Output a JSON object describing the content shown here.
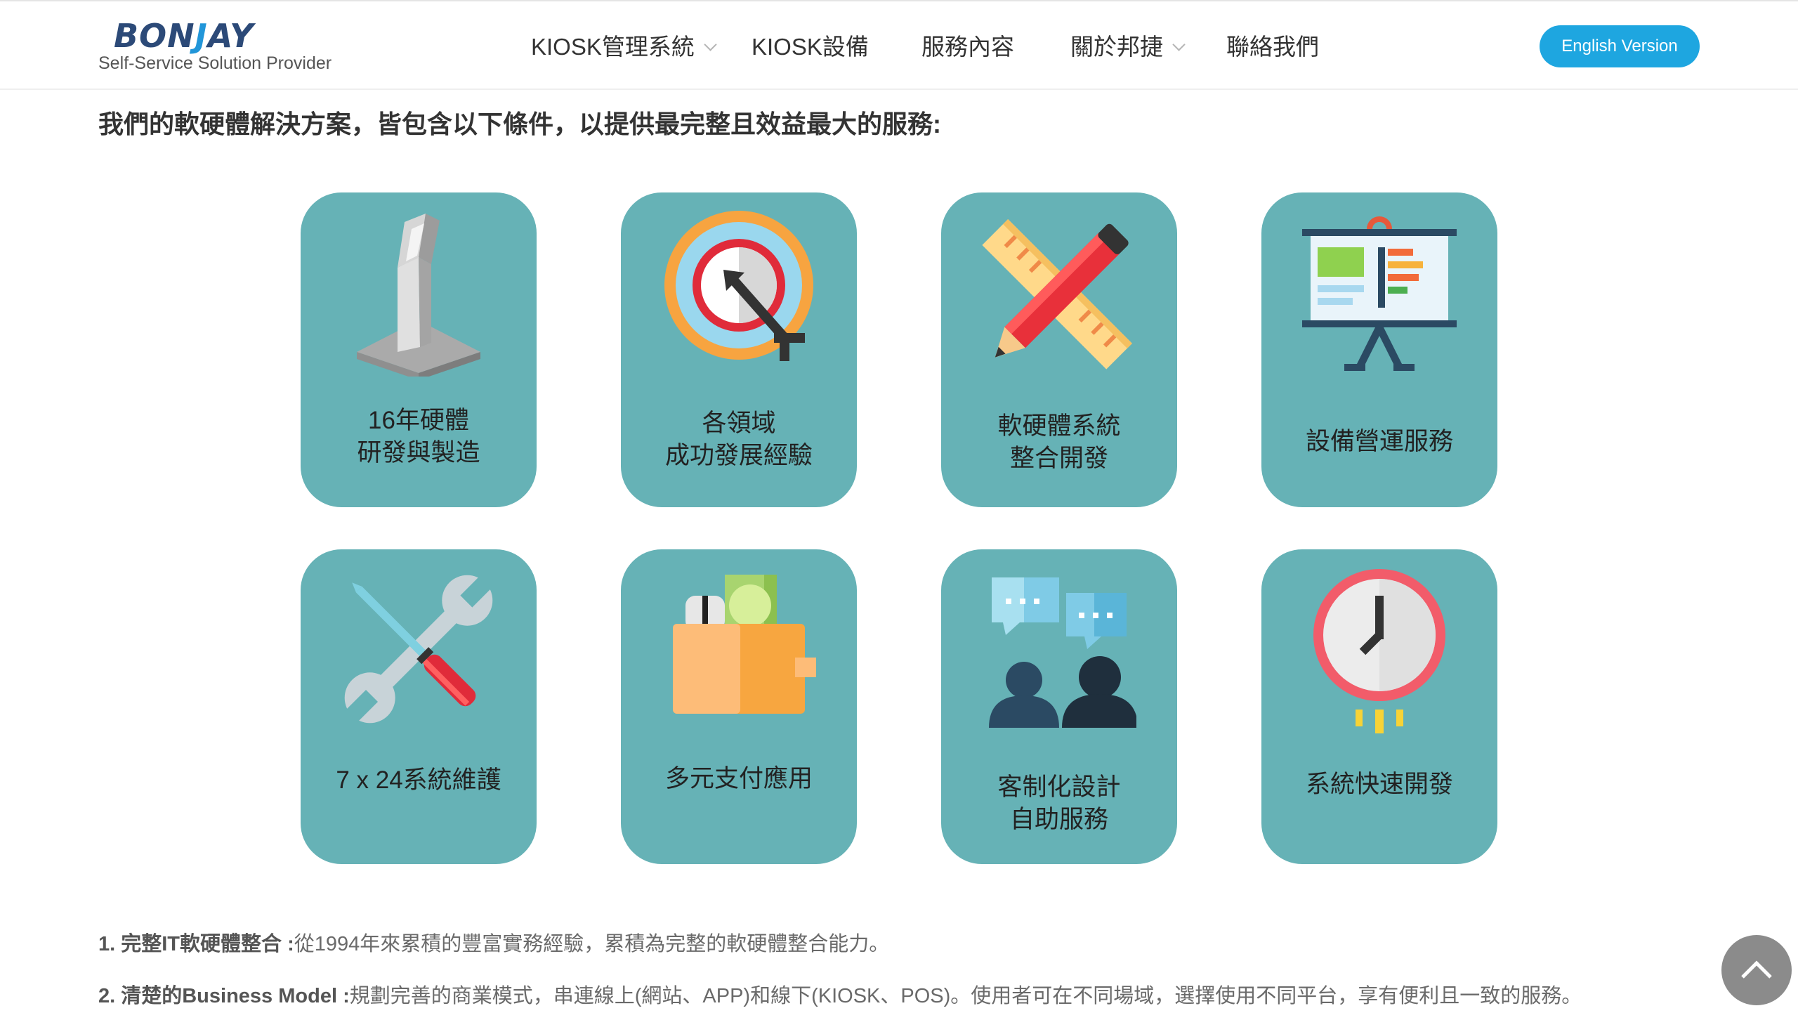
{
  "header": {
    "logo": {
      "word_part1": "BON",
      "word_mark": "J",
      "word_part2": "AY",
      "tagline": "Self-Service Solution Provider"
    },
    "nav": [
      {
        "label": "KIOSK管理系統",
        "has_dropdown": true
      },
      {
        "label": "KIOSK設備",
        "has_dropdown": false
      },
      {
        "label": "服務內容",
        "has_dropdown": false
      },
      {
        "label": "關於邦捷",
        "has_dropdown": true
      },
      {
        "label": "聯絡我們",
        "has_dropdown": false
      }
    ],
    "english_button": "English Version"
  },
  "intro": "我們的軟硬體解決方案，皆包含以下條件，以提供最完整且效益最大的服務:",
  "cards": [
    {
      "icon": "kiosk-icon",
      "line1": "16年硬體",
      "line2": "研發與製造"
    },
    {
      "icon": "target-icon",
      "line1": "各領域",
      "line2": "成功發展經驗"
    },
    {
      "icon": "pencil-ruler-icon",
      "line1": "軟硬體系統",
      "line2": "整合開發"
    },
    {
      "icon": "presentation-board-icon",
      "line1": "設備營運服務",
      "line2": ""
    },
    {
      "icon": "tools-icon",
      "line1": "7 x 24系統維護",
      "line2": ""
    },
    {
      "icon": "wallet-payment-icon",
      "line1": "多元支付應用",
      "line2": ""
    },
    {
      "icon": "chat-users-icon",
      "line1": "客制化設計",
      "line2": "自助服務"
    },
    {
      "icon": "clock-icon",
      "line1": "系統快速開發",
      "line2": ""
    }
  ],
  "points": [
    {
      "title": "1. 完整IT軟硬體整合 :",
      "text": "從1994年來累積的豐富實務經驗，累積為完整的軟硬體整合能力。"
    },
    {
      "title": "2. 清楚的Business Model :",
      "text": "規劃完善的商業模式，串連線上(網站、APP)和線下(KIOSK、POS)。使用者可在不同場域，選擇使用不同平台，享有便利且一致的服務。"
    }
  ],
  "colors": {
    "card_bg": "#66b2b6",
    "button_bg": "#1ea6e0",
    "scroll_top_bg": "#8b8b8b"
  }
}
